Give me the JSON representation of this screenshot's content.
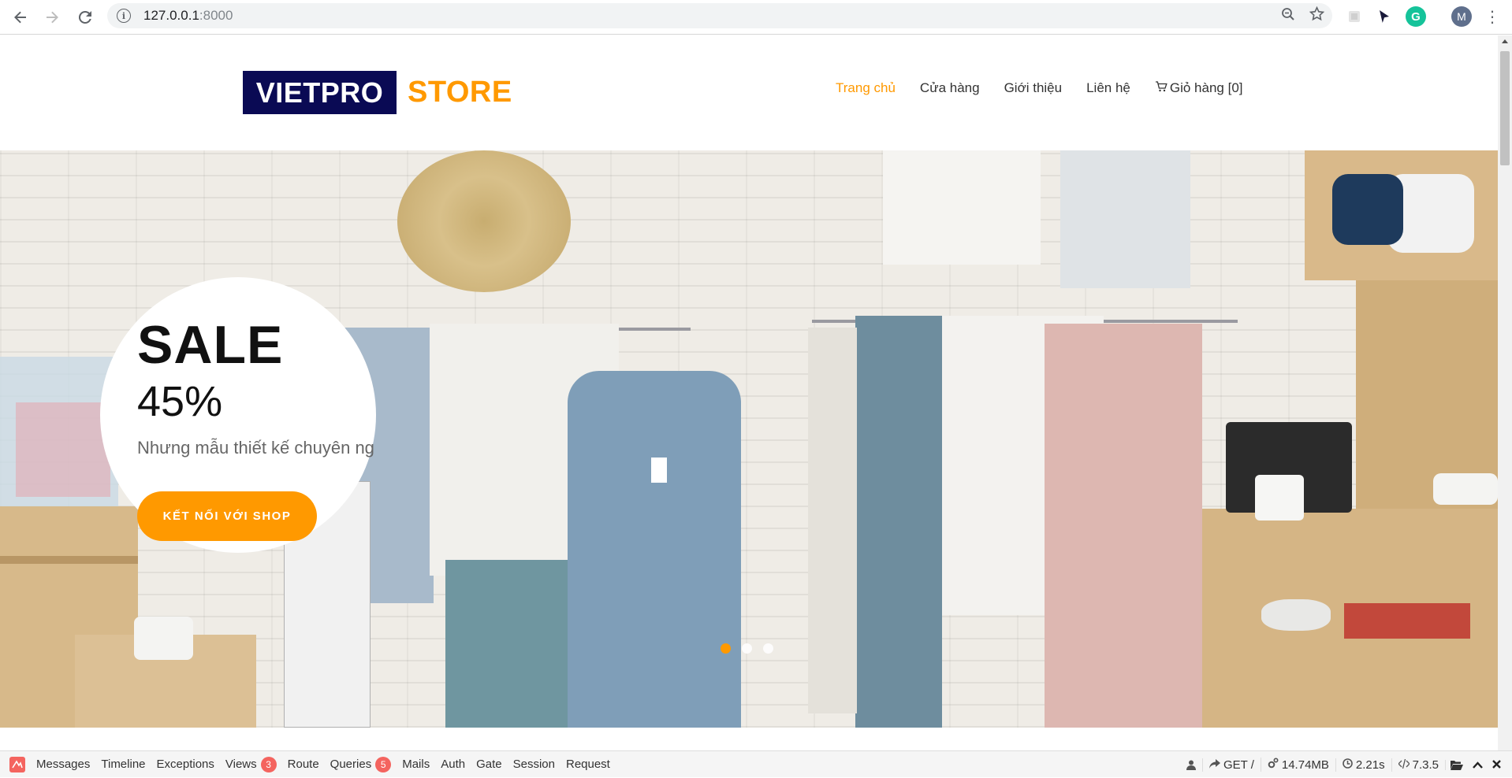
{
  "browser": {
    "url_host": "127.0.0.1",
    "url_port": ":8000",
    "profile_initial": "M",
    "extension_letter": "G"
  },
  "site": {
    "logo_main": "VIETPRO",
    "logo_accent": "STORE",
    "menu": [
      {
        "label": "Trang chủ",
        "active": true
      },
      {
        "label": "Cửa hàng",
        "active": false
      },
      {
        "label": "Giới thiệu",
        "active": false
      },
      {
        "label": "Liên hệ",
        "active": false
      },
      {
        "label": "Giỏ hàng [0]",
        "active": false
      }
    ],
    "accent_color": "#ff9900",
    "logo_bg_color": "#0a0a54"
  },
  "hero": {
    "title": "SALE",
    "percent": "45%",
    "subtitle": "Nhưng mẫu thiết kế chuyên nghiệp",
    "cta_label": "KẾT NỐI VỚI SHOP",
    "slide_count": 3,
    "active_slide": 1
  },
  "debugbar": {
    "tabs": [
      {
        "label": "Messages"
      },
      {
        "label": "Timeline"
      },
      {
        "label": "Exceptions"
      },
      {
        "label": "Views",
        "badge": "3"
      },
      {
        "label": "Route"
      },
      {
        "label": "Queries",
        "badge": "5"
      },
      {
        "label": "Mails"
      },
      {
        "label": "Auth"
      },
      {
        "label": "Gate"
      },
      {
        "label": "Session"
      },
      {
        "label": "Request"
      }
    ],
    "method": "GET /",
    "memory": "14.74MB",
    "time": "2.21s",
    "php_version": "7.3.5"
  }
}
